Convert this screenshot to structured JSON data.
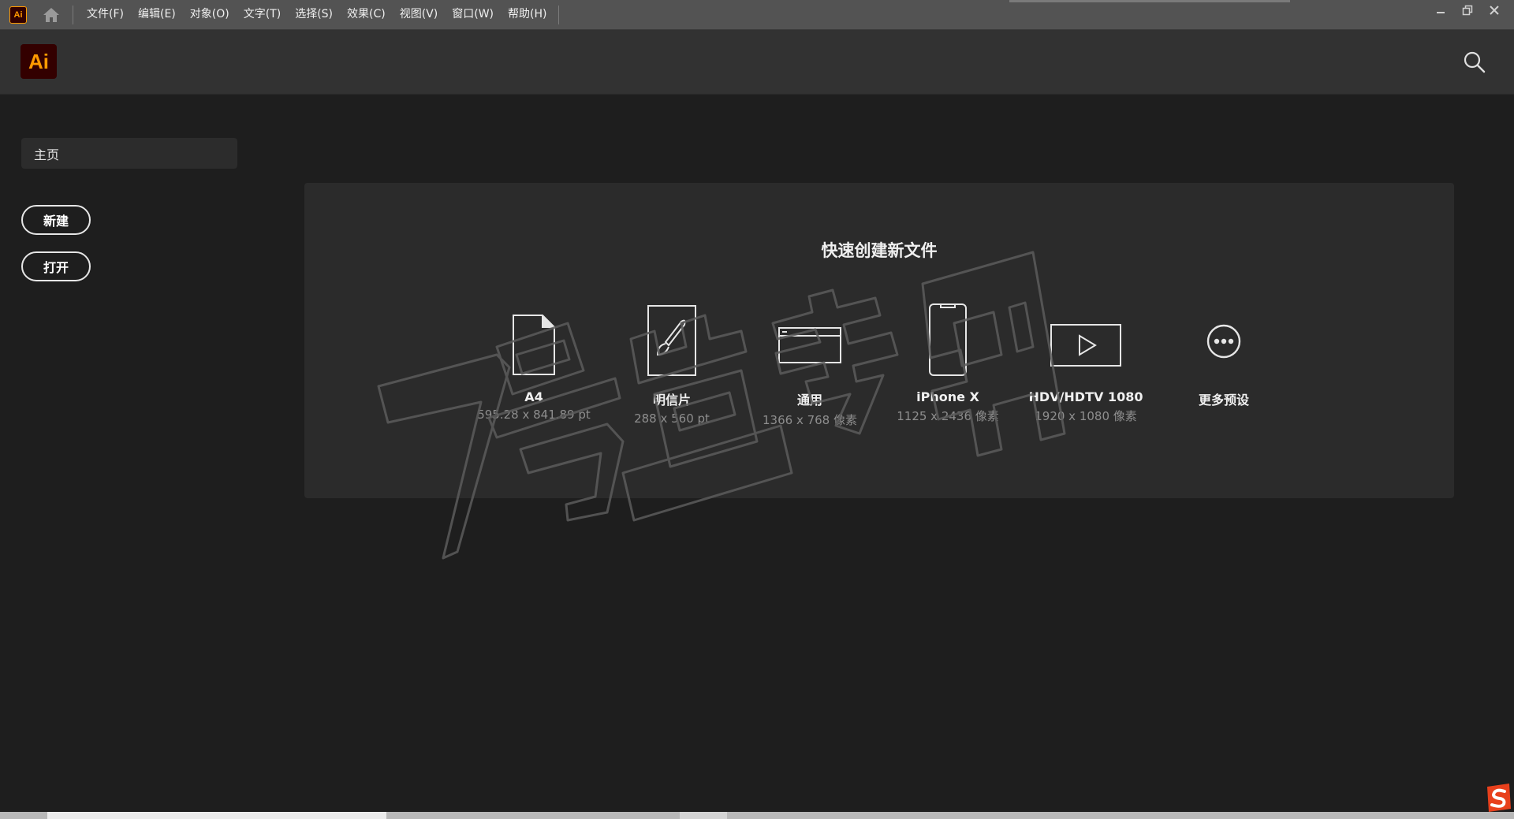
{
  "menubar": {
    "logo": "Ai",
    "items": [
      "文件(F)",
      "编辑(E)",
      "对象(O)",
      "文字(T)",
      "选择(S)",
      "效果(C)",
      "视图(V)",
      "窗口(W)",
      "帮助(H)"
    ]
  },
  "header": {
    "logo": "Ai"
  },
  "sidebar": {
    "home_tab": "主页",
    "new_button": "新建",
    "open_button": "打开"
  },
  "quick_create": {
    "title": "快速创建新文件",
    "presets": [
      {
        "name": "A4",
        "dims": "595.28 x 841.89 pt",
        "icon": "document-icon"
      },
      {
        "name": "明信片",
        "dims": "288 x 560 pt",
        "icon": "brush-card-icon"
      },
      {
        "name": "通用",
        "dims": "1366 x 768 像素",
        "icon": "browser-window-icon"
      },
      {
        "name": "iPhone X",
        "dims": "1125 x 2436 像素",
        "icon": "phone-icon"
      },
      {
        "name": "HDV/HDTV 1080",
        "dims": "1920 x 1080 像素",
        "icon": "video-play-icon"
      },
      {
        "name": "更多预设",
        "dims": "",
        "icon": "more-icon"
      }
    ]
  },
  "watermark": "7号营专用",
  "colors": {
    "brand_orange": "#ff9a00",
    "brand_dark": "#330000",
    "panel": "#2b2b2b"
  }
}
